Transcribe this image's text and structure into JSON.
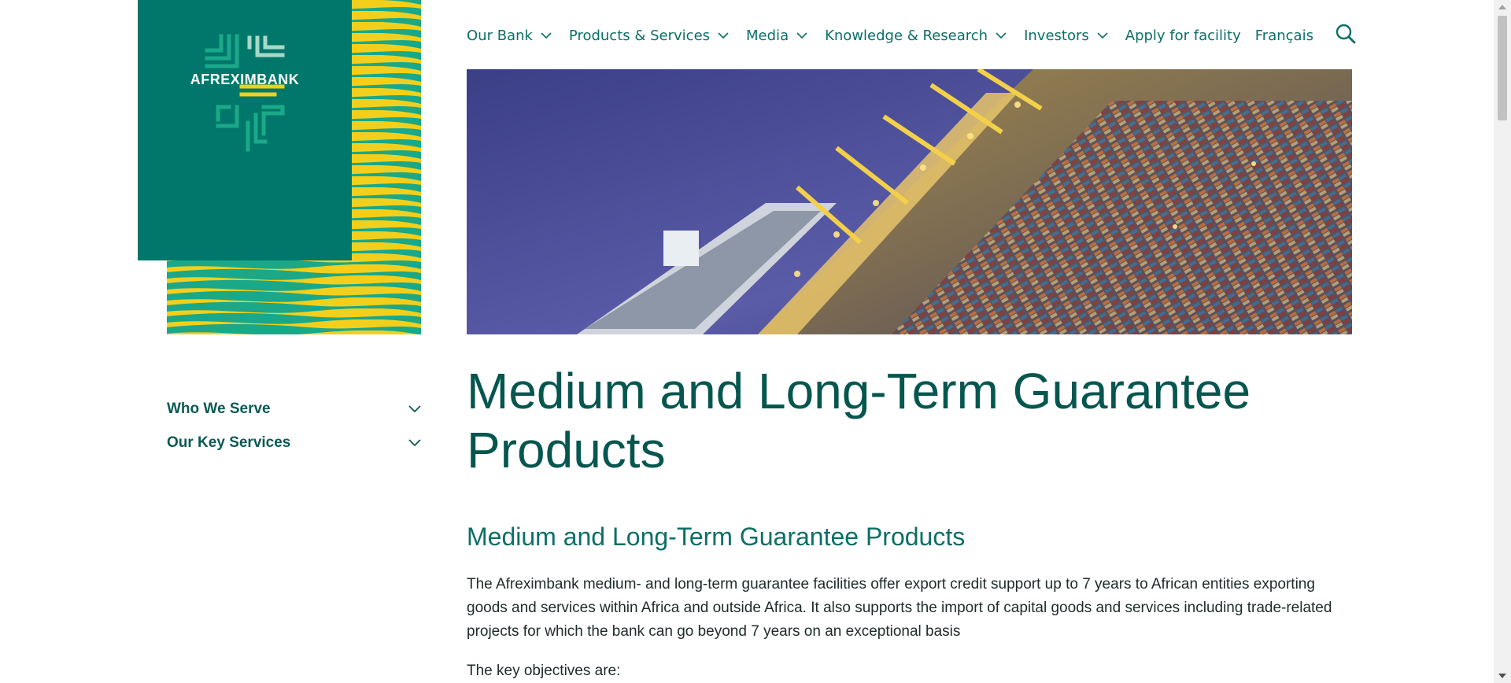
{
  "brand": {
    "name": "AFREXIMBANK",
    "colors": {
      "primary": "#00776a",
      "accent_yellow": "#f3cf1b",
      "accent_green": "#1aa889",
      "link": "#0b6f66"
    }
  },
  "nav": {
    "items": [
      {
        "label": "Our Bank",
        "has_dropdown": true
      },
      {
        "label": "Products & Services",
        "has_dropdown": true
      },
      {
        "label": "Media",
        "has_dropdown": true
      },
      {
        "label": "Knowledge & Research",
        "has_dropdown": true
      },
      {
        "label": "Investors",
        "has_dropdown": true
      },
      {
        "label": "Apply for facility",
        "has_dropdown": false
      },
      {
        "label": "Français",
        "has_dropdown": false
      }
    ],
    "search_icon": "search-icon"
  },
  "hero": {
    "icon": "port-aerial-photo"
  },
  "sidebar": {
    "items": [
      {
        "label": "Who We Serve"
      },
      {
        "label": "Our Key Services"
      }
    ]
  },
  "main": {
    "title": "Medium and Long-Term Guarantee Products",
    "section_title": "Medium and Long-Term Guarantee Products",
    "paragraph": "The Afreximbank medium- and long-term guarantee facilities offer export credit support up to 7 years to African entities exporting goods and services within Africa and outside Africa. It also supports the import of capital goods and services including trade-related projects for which the bank can go beyond 7 years on an exceptional basis",
    "objectives_intro": "The key objectives are:"
  }
}
